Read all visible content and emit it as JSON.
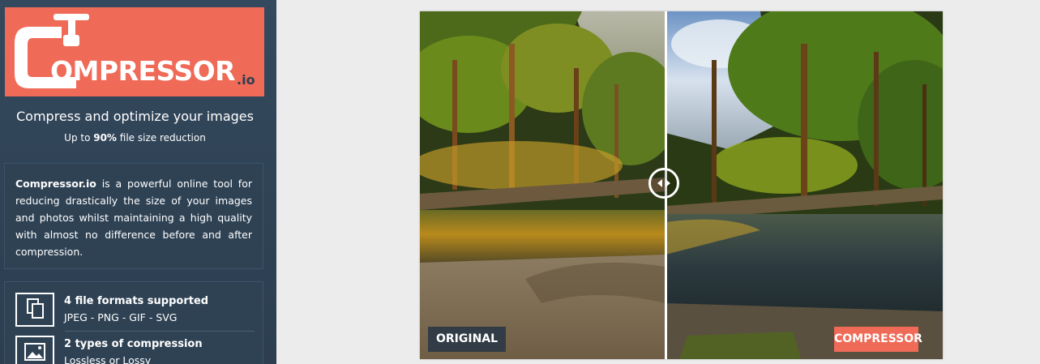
{
  "brand": {
    "name": "OMPRESSOR",
    "suffix": ".io",
    "accent_color": "#ef6a57",
    "dark_color": "#2c3e50"
  },
  "tagline": "Compress and optimize your images",
  "subline": {
    "prefix": "Up to ",
    "highlight": "90%",
    "suffix": " file size reduction"
  },
  "description": {
    "bold": "Compressor.io",
    "text": " is a powerful online tool for reducing drastically the size of your images and photos whilst maintaining a high quality with almost no difference before and after compression."
  },
  "features": [
    {
      "icon": "files-icon",
      "title": "4 file formats supported",
      "subtitle": "JPEG - PNG - GIF - SVG"
    },
    {
      "icon": "image-icon",
      "title": "2 types of compression",
      "subtitle": "Lossless or Lossy"
    }
  ],
  "comparison": {
    "left_label": "ORIGINAL",
    "right_label": "COMPRESSOR",
    "handle_icon": "compare-arrows-icon",
    "split_position": 0.47
  }
}
